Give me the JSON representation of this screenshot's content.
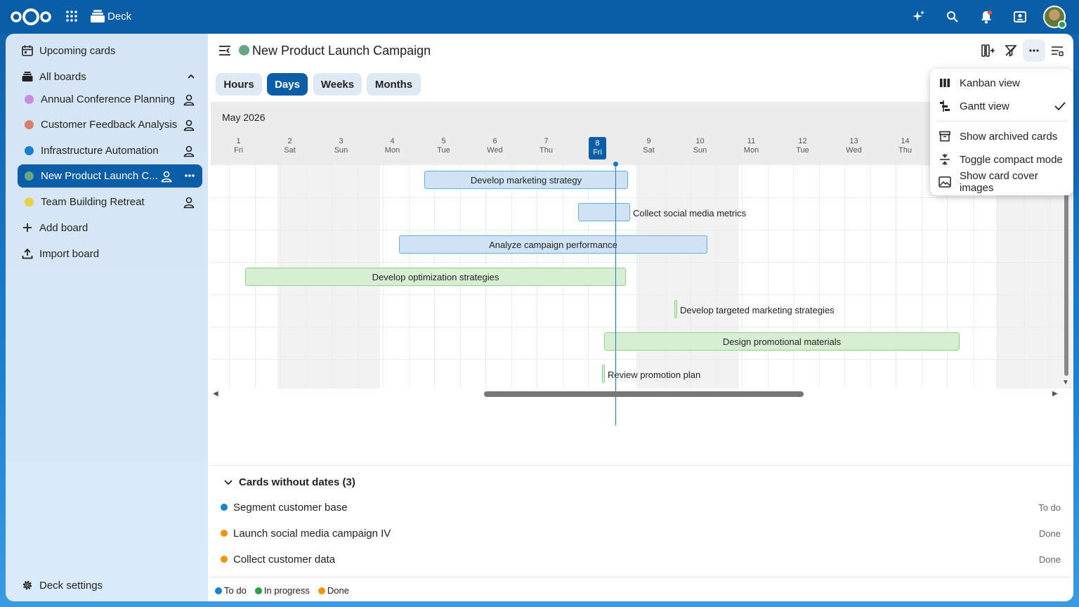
{
  "app": {
    "name": "Deck"
  },
  "sidebar": {
    "upcoming": "Upcoming cards",
    "all_boards": "All boards",
    "boards": [
      {
        "label": "Annual Conference Planning",
        "color": "#c98be0"
      },
      {
        "label": "Customer Feedback Analysis",
        "color": "#d9806a"
      },
      {
        "label": "Infrastructure Automation",
        "color": "#1a7fcf"
      },
      {
        "label": "New Product Launch C...",
        "color": "#6aa583"
      },
      {
        "label": "Team Building Retreat",
        "color": "#e8d04a"
      }
    ],
    "add_board": "Add board",
    "import_board": "Import board",
    "settings": "Deck settings"
  },
  "header": {
    "title": "New Product Launch Campaign",
    "title_color": "#6aa583"
  },
  "views": {
    "hours": "Hours",
    "days": "Days",
    "weeks": "Weeks",
    "months": "Months",
    "active": "Days"
  },
  "gantt": {
    "month": "May 2026",
    "days": [
      {
        "num": "1",
        "dow": "Fri"
      },
      {
        "num": "2",
        "dow": "Sat"
      },
      {
        "num": "3",
        "dow": "Sun"
      },
      {
        "num": "4",
        "dow": "Mon"
      },
      {
        "num": "5",
        "dow": "Tue"
      },
      {
        "num": "6",
        "dow": "Wed"
      },
      {
        "num": "7",
        "dow": "Thu"
      },
      {
        "num": "8",
        "dow": "Fri"
      },
      {
        "num": "9",
        "dow": "Sat"
      },
      {
        "num": "10",
        "dow": "Sun"
      },
      {
        "num": "11",
        "dow": "Mon"
      },
      {
        "num": "12",
        "dow": "Tue"
      },
      {
        "num": "13",
        "dow": "Wed"
      },
      {
        "num": "14",
        "dow": "Thu"
      }
    ],
    "today": "8",
    "tasks": [
      "Develop marketing strategy",
      "Collect social media metrics",
      "Analyze campaign performance",
      "Develop optimization strategies",
      "Develop targeted marketing strategies",
      "Design promotional materials",
      "Review promotion plan"
    ]
  },
  "no_dates": {
    "title": "Cards without dates (3)",
    "cards": [
      {
        "label": "Segment customer base",
        "status": "To do",
        "color": "#1a7fcf"
      },
      {
        "label": "Launch social media campaign IV",
        "status": "Done",
        "color": "#f0950a"
      },
      {
        "label": "Collect customer data",
        "status": "Done",
        "color": "#f0950a"
      }
    ]
  },
  "legend": [
    {
      "label": "To do",
      "color": "#1a7fcf"
    },
    {
      "label": "In progress",
      "color": "#2c9e4b"
    },
    {
      "label": "Done",
      "color": "#f0950a"
    }
  ],
  "dropdown": {
    "kanban": "Kanban view",
    "gantt": "Gantt view",
    "archived": "Show archived cards",
    "compact": "Toggle compact mode",
    "covers": "Show card cover images"
  }
}
